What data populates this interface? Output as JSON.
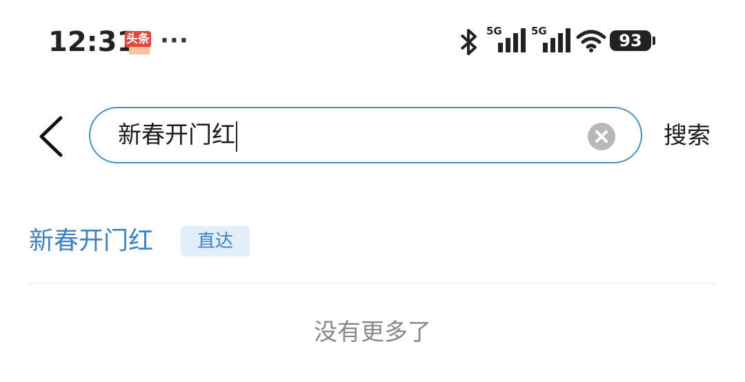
{
  "status_bar": {
    "time": "12:31",
    "app_badge_label": "头条",
    "more_indicator": "···",
    "network_1": "5G",
    "network_2": "5G",
    "battery_level": "93",
    "icons": [
      "bluetooth-icon",
      "signal-icon",
      "wifi-icon",
      "battery-icon"
    ]
  },
  "header": {
    "back_icon": "chevron-left-icon",
    "search_value": "新春开门红",
    "clear_icon": "clear-icon",
    "search_button_label": "搜索",
    "accent_color": "#4a8ec2"
  },
  "suggestions": [
    {
      "text": "新春开门红",
      "tag": "直达"
    }
  ],
  "footer_text": "没有更多了",
  "colors": {
    "link": "#3d82c4",
    "tag_bg": "#e3eefb",
    "muted": "#888888"
  }
}
